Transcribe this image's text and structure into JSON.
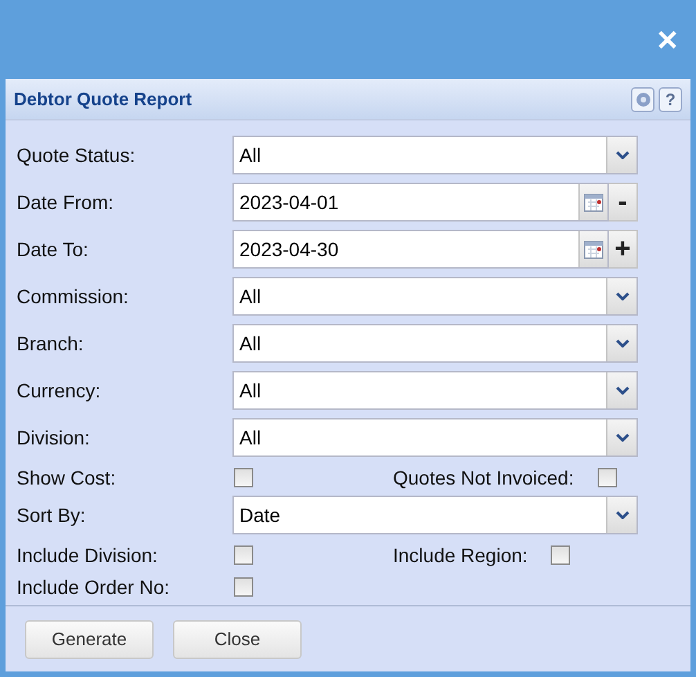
{
  "window": {
    "close": "✕"
  },
  "panel": {
    "title": "Debtor Quote Report",
    "help": "?"
  },
  "rows": [
    {
      "kind": "select",
      "label": "Quote Status:",
      "value": "All"
    },
    {
      "kind": "date",
      "label": "Date From:",
      "value": "2023-04-01",
      "step": "-"
    },
    {
      "kind": "date",
      "label": "Date To:",
      "value": "2023-04-30",
      "step": "+"
    },
    {
      "kind": "select",
      "label": "Commission:",
      "value": "All"
    },
    {
      "kind": "select",
      "label": "Branch:",
      "value": "All"
    },
    {
      "kind": "select",
      "label": "Currency:",
      "value": "All"
    },
    {
      "kind": "select",
      "label": "Division:",
      "value": "All"
    },
    {
      "kind": "checks",
      "items": [
        {
          "label": "Show Cost:",
          "checked": false
        },
        {
          "label": "Quotes Not Invoiced:",
          "checked": false
        }
      ]
    },
    {
      "kind": "select",
      "label": "Sort By:",
      "value": "Date"
    },
    {
      "kind": "checks",
      "items": [
        {
          "label": "Include Division:",
          "checked": false
        },
        {
          "label": "Include Region:",
          "checked": false
        }
      ]
    },
    {
      "kind": "checks",
      "items": [
        {
          "label": "Include Order No:",
          "checked": false
        }
      ]
    }
  ],
  "buttons": [
    "Generate",
    "Close"
  ]
}
